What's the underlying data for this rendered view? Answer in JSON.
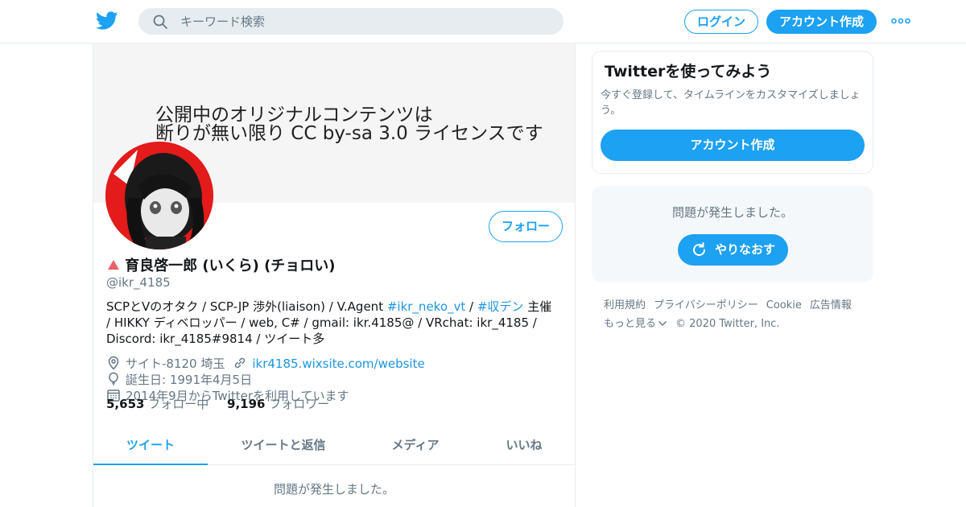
{
  "header": {
    "search_placeholder": "キーワード検索",
    "login_label": "ログイン",
    "signup_label": "アカウント作成"
  },
  "banner": {
    "line1": "公開中のオリジナルコンテンツは",
    "line2": "断りが無い限り CC by-sa 3.0 ライセンスです"
  },
  "profile": {
    "name": "育良啓一郎 (いくら) (チョロい)",
    "handle": "@ikr_4185",
    "follow_label": "フォロー",
    "bio": {
      "part1": "SCPとVのオタク / SCP-JP 渉外(liaison) / V.Agent ",
      "tag1": "#ikr_neko_vt",
      "sep": " / ",
      "tag2": "#収デン",
      "part2": " 主催 / HIKKY ディベロッパー / web, C# / gmail: ikr.4185@ / VRchat: ikr_4185 / Discord: ikr_4185#9814 / ツイート多"
    },
    "location": "サイト-8120 埼玉",
    "website": "ikr4185.wixsite.com/website",
    "birthday": "誕生日: 1991年4月5日",
    "joined": "2014年9月からTwitterを利用しています",
    "following_count": "5,653",
    "following_label": "フォロー中",
    "followers_count": "9,196",
    "followers_label": "フォロワー"
  },
  "tabs": [
    "ツイート",
    "ツイートと返信",
    "メディア",
    "いいね"
  ],
  "main_error": "問題が発生しました。",
  "sidebar": {
    "card_title": "Twitterを使ってみよう",
    "card_desc": "今すぐ登録して、タイムラインをカスタマイズしましょう。",
    "card_button": "アカウント作成",
    "error_text": "問題が発生しました。",
    "retry_label": "やりなおす"
  },
  "footer": {
    "terms": "利用規約",
    "privacy": "プライバシーポリシー",
    "cookie": "Cookie",
    "ads": "広告情報",
    "more": "もっと見る",
    "copyright": "© 2020 Twitter, Inc."
  },
  "colors": {
    "accent": "#1da1f2",
    "link": "#1b95e0",
    "muted": "#657786",
    "avatar_bg": "#e31b1b"
  },
  "icons": [
    "twitter-logo-icon",
    "search-icon",
    "more-dots-icon",
    "location-icon",
    "link-icon",
    "balloon-icon",
    "calendar-icon",
    "refresh-icon",
    "chevron-down-icon",
    "warning-triangle-icon"
  ]
}
